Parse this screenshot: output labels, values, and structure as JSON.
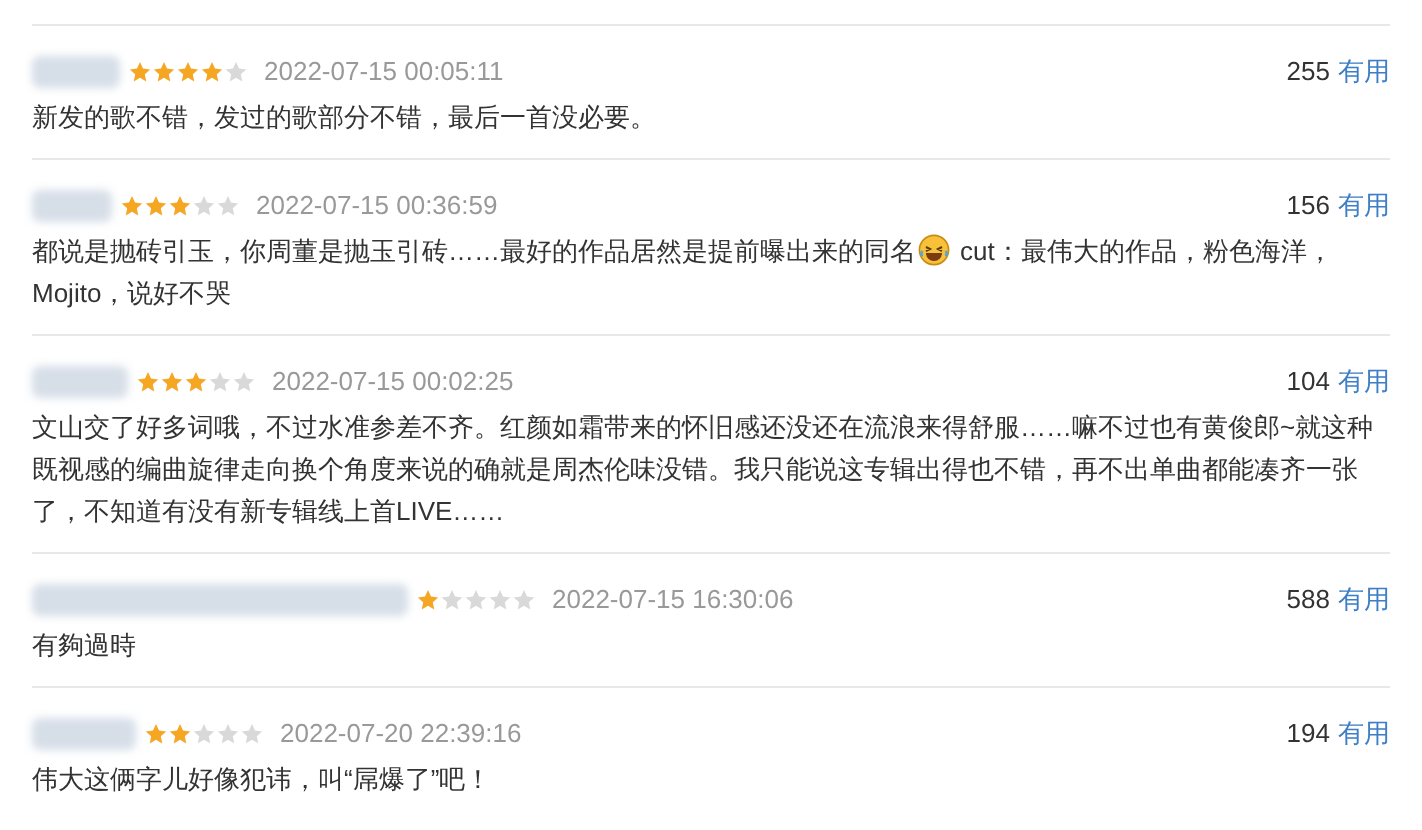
{
  "reviews": [
    {
      "stars": 4,
      "time": "2022-07-15 00:05:11",
      "count": "255",
      "useful": "有用",
      "text": [
        "新发的歌不错，发过的歌部分不错，最后一首没必要。"
      ]
    },
    {
      "stars": 3,
      "time": "2022-07-15 00:36:59",
      "count": "156",
      "useful": "有用",
      "parts": [
        {
          "kind": "text",
          "text": "都说是抛砖引玉，你周董是抛玉引砖……最好的作品居然是提前曝出来的同名"
        },
        {
          "kind": "emoji"
        },
        {
          "kind": "text",
          "text": "cut：最伟大的作品，粉色海洋，"
        },
        {
          "kind": "text",
          "text": "Mojito，说好不哭"
        }
      ]
    },
    {
      "stars": 3,
      "time": "2022-07-15 00:02:25",
      "count": "104",
      "useful": "有用",
      "text": [
        "文山交了好多词哦，不过水准参差不齐。红颜如霜带来的怀旧感还没还在流浪来得舒服……嘛不过也有黄俊郎~就这种既视感的编曲旋律走向换个角度来说的确就是周杰伦味没错。我只能说这专辑出得也不错，再不出单曲都能凑齐一张了，不知道有没有新专辑线上首LIVE……"
      ]
    },
    {
      "stars": 1,
      "time": "2022-07-15 16:30:06",
      "count": "588",
      "useful": "有用",
      "text": [
        "有夠過時"
      ]
    },
    {
      "stars": 2,
      "time": "2022-07-20 22:39:16",
      "count": "194",
      "useful": "有用",
      "text": [
        "伟大这俩字儿好像犯讳，叫“屌爆了”吧！"
      ]
    }
  ]
}
